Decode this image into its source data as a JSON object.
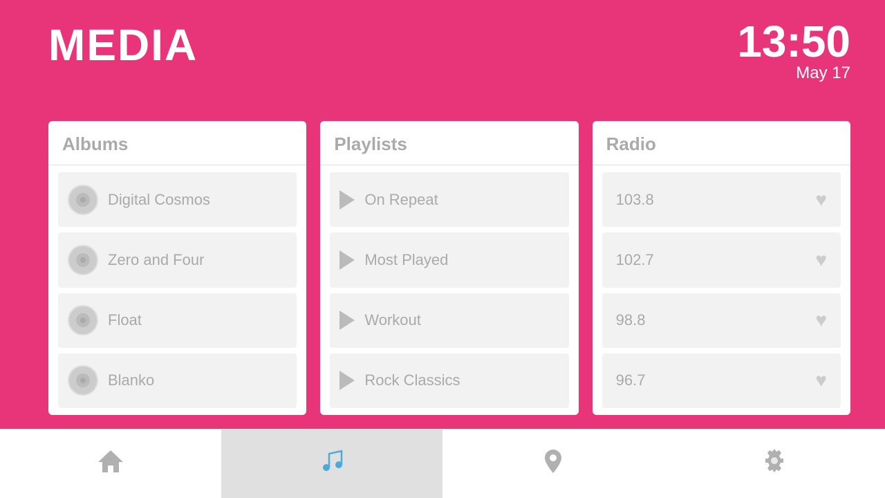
{
  "header": {
    "title": "MEDIA",
    "time": "13:50",
    "date": "May 17"
  },
  "albums": {
    "panel_title": "Albums",
    "items": [
      {
        "name": "Digital Cosmos"
      },
      {
        "name": "Zero and Four"
      },
      {
        "name": "Float"
      },
      {
        "name": "Blanko"
      }
    ]
  },
  "playlists": {
    "panel_title": "Playlists",
    "items": [
      {
        "name": "On Repeat"
      },
      {
        "name": "Most Played"
      },
      {
        "name": "Workout"
      },
      {
        "name": "Rock Classics"
      }
    ]
  },
  "radio": {
    "panel_title": "Radio",
    "items": [
      {
        "freq": "103.8"
      },
      {
        "freq": "102.7"
      },
      {
        "freq": "98.8"
      },
      {
        "freq": "96.7"
      }
    ]
  },
  "nav": {
    "home_label": "home",
    "music_label": "music",
    "location_label": "location",
    "settings_label": "settings"
  }
}
